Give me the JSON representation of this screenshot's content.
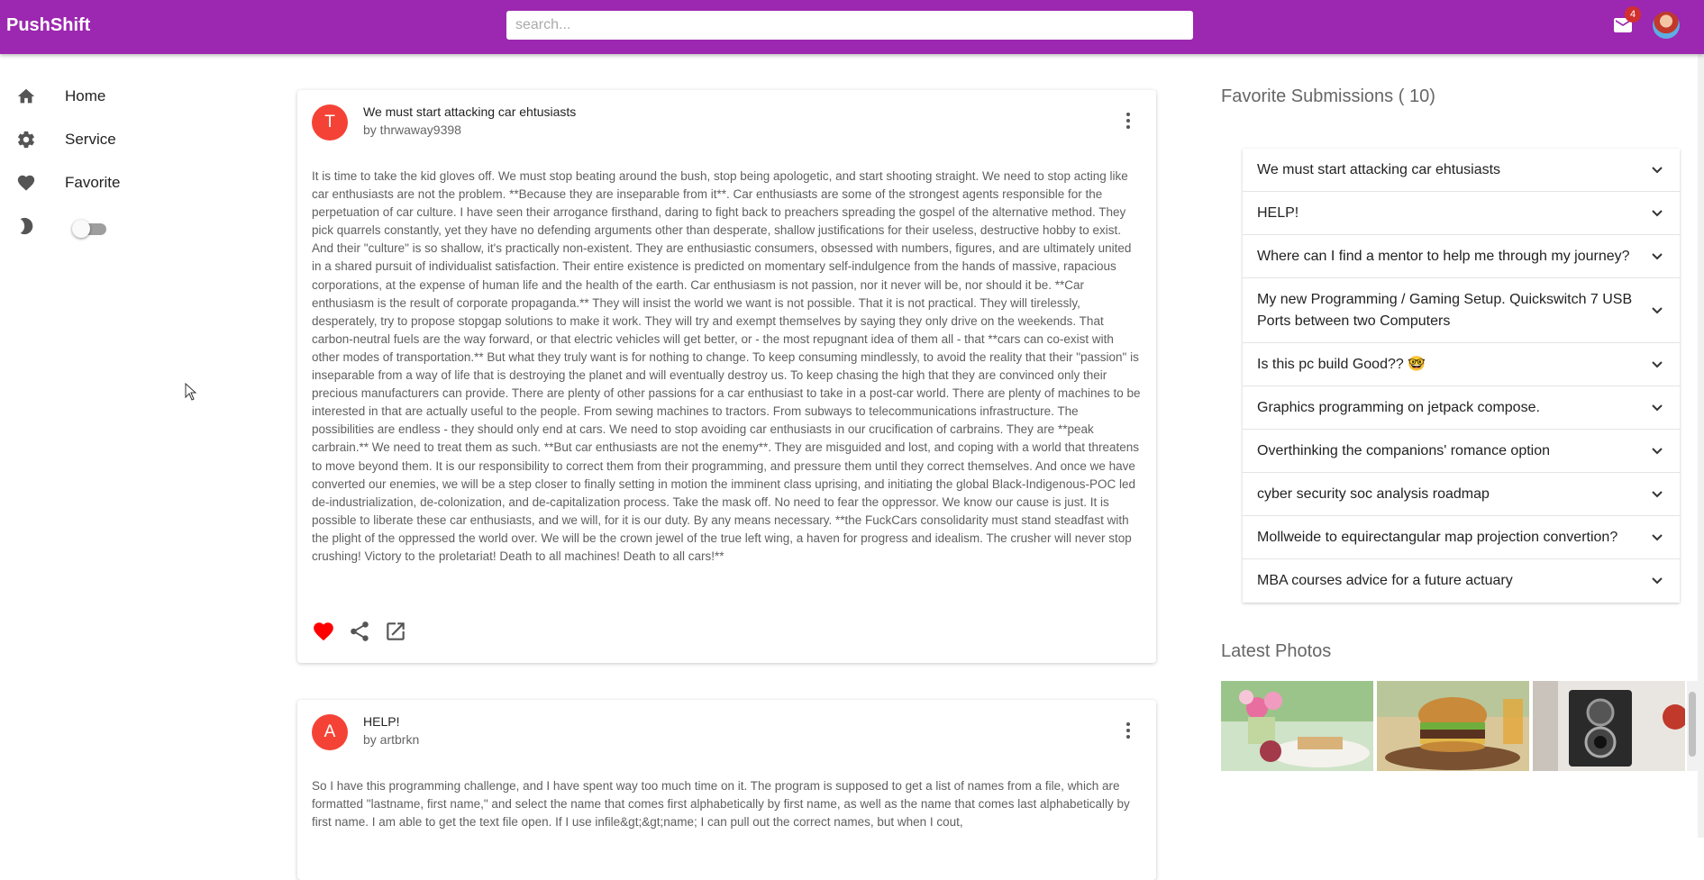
{
  "app": {
    "title": "PushShift",
    "accent": "#9c27b0"
  },
  "search": {
    "placeholder": "search..."
  },
  "notifications": {
    "count": "4"
  },
  "sidebar": {
    "items": [
      {
        "label": "Home",
        "icon": "home-icon"
      },
      {
        "label": "Service",
        "icon": "gear-icon"
      },
      {
        "label": "Favorite",
        "icon": "heart-icon"
      }
    ],
    "theme_toggle": {
      "icon": "moon-icon",
      "on": false
    }
  },
  "posts": [
    {
      "avatar_letter": "T",
      "title": "We must start attacking car ehtusiasts",
      "author": "by thrwaway9398",
      "body": "It is time to take the kid gloves off. We must stop beating around the bush, stop being apologetic, and start shooting straight. We need to stop acting like car enthusiasts are not the problem. **Because they are inseparable from it**. Car enthusiasts are some of the strongest agents responsible for the perpetuation of car culture. I have seen their arrogance firsthand, daring to fight back to preachers spreading the gospel of the alternative method. They pick quarrels constantly, yet they have no defending arguments other than desperate, shallow justifications for their useless, destructive hobby to exist. And their \"culture\" is so shallow, it's practically non-existent. They are enthusiastic consumers, obsessed with numbers, figures, and are ultimately united in a shared pursuit of individualist satisfaction. Their entire existence is predicted on momentary self-indulgence from the hands of massive, rapacious corporations, at the expense of human life and the health of the earth. Car enthusiasm is not passion, nor it never will be, nor should it be. **Car enthusiasm is the result of corporate propaganda.** They will insist the world we want is not possible. That it is not practical. They will tirelessly, desperately, try to propose stopgap solutions to make it work. They will try and exempt themselves by saying they only drive on the weekends. That carbon-neutral fuels are the way forward, or that electric vehicles will get better, or - the most repugnant idea of them all - that **cars can co-exist with other modes of transportation.** But what they truly want is for nothing to change. To keep consuming mindlessly, to avoid the reality that their \"passion\" is inseparable from a way of life that is destroying the planet and will eventually destroy us. To keep chasing the high that they are convinced only their precious manufacturers can provide. There are plenty of other passions for a car enthusiast to take in a post-car world. There are plenty of machines to be interested in that are actually useful to the people. From sewing machines to tractors. From subways to telecommunications infrastructure. The possibilities are endless - they should only end at cars. We need to stop avoiding car enthusiasts in our crucification of carbrains. They are **peak carbrain.** We need to treat them as such. **But car enthusiasts are not the enemy**. They are misguided and lost, and coping with a world that threatens to move beyond them. It is our responsibility to correct them from their programming, and pressure them until they correct themselves. And once we have converted our enemies, we will be a step closer to finally setting in motion the imminent class uprising, and initiating the global Black-Indigenous-POC led de-industrialization, de-colonization, and de-capitalization process. Take the mask off. No need to fear the oppressor. We know our cause is just. It is possible to liberate these car enthusiasts, and we will, for it is our duty. By any means necessary. **the FuckCars consolidarity must stand steadfast with the plight of the oppressed the world over. We will be the crown jewel of the true left wing, a haven for progress and idealism. The crusher will never stop crushing! Victory to the proletariat! Death to all machines! Death to all cars!**"
    },
    {
      "avatar_letter": "A",
      "title": "HELP!",
      "author": "by artbrkn",
      "body": "So I have this programming challenge, and I have spent way too much time on it. The program is supposed to get a list of names from a file, which are formatted \"lastname, first name,\" and select the name that comes first alphabetically by first name, as well as the name that comes last alphabetically by first name. I am able to get the text file open. If I use infile&gt;&gt;name; I can pull out the correct names, but when I cout,"
    }
  ],
  "favorites": {
    "title": "Favorite Submissions ( 10)",
    "items": [
      "We must start attacking car ehtusiasts",
      "HELP!",
      "Where can I find a mentor to help me through my journey?",
      "My new Programming / Gaming Setup. Quickswitch 7 USB Ports between two Computers",
      "Is this pc build Good?? 🤓",
      "Graphics programming on jetpack compose.",
      "Overthinking the companions' romance option",
      "cyber security soc analysis roadmap",
      "Mollweide to equirectangular map projection convertion?",
      "MBA courses advice for a future actuary"
    ]
  },
  "photos": {
    "title": "Latest Photos",
    "items": [
      "flowers-breakfast-photo",
      "burger-photo",
      "vintage-camera-photo"
    ]
  }
}
